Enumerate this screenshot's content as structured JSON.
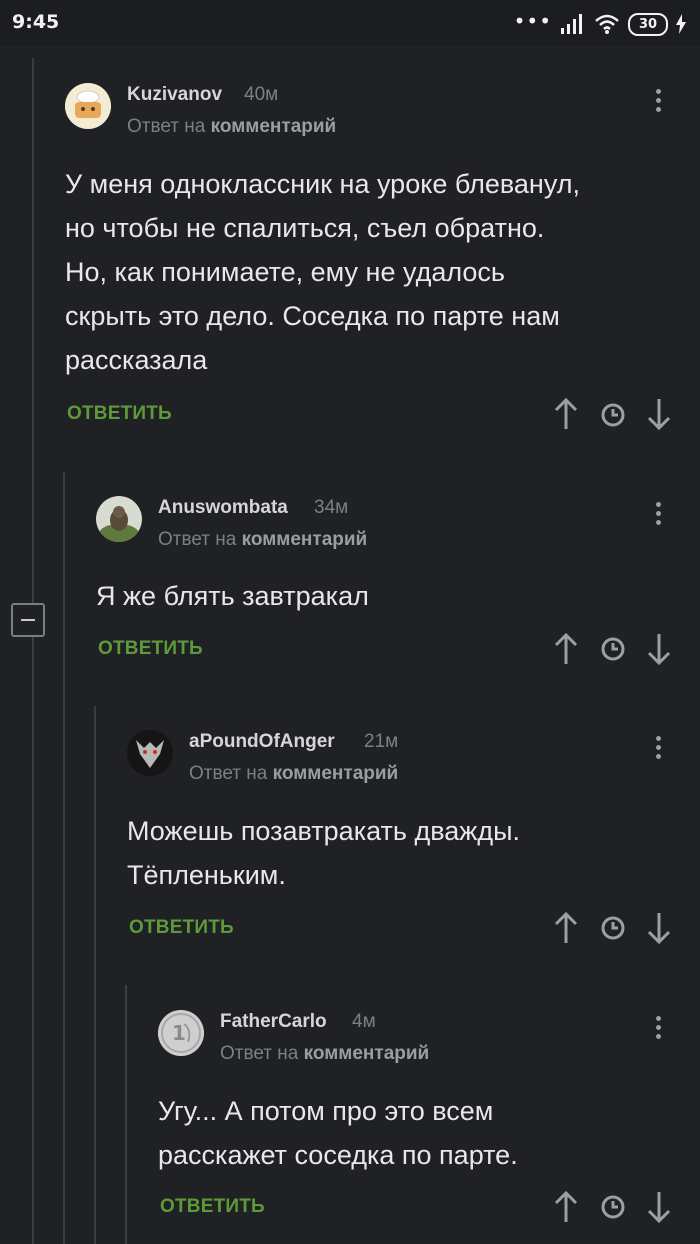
{
  "statusbar": {
    "time": "9:45",
    "battery": "30"
  },
  "labels": {
    "reply_to_prefix": "Ответ на",
    "reply_to_link": "комментарий",
    "reply_button": "ОТВЕТИТЬ"
  },
  "comments": [
    {
      "username": "Kuzivanov",
      "time": "40м",
      "text": [
        "У меня одноклассник на уроке блеванул,",
        "но чтобы не спалиться, съел обратно.",
        "Но, как понимаете, ему не удалось",
        "скрыть это дело. Соседка по парте нам",
        "рассказала"
      ]
    },
    {
      "username": "Anuswombata",
      "time": "34м",
      "text": [
        "Я же блять завтракал"
      ]
    },
    {
      "username": "aPoundOfAnger",
      "time": "21м",
      "text": [
        "Можешь позавтракать дважды.",
        "Тёпленьким."
      ]
    },
    {
      "username": "FatherCarlo",
      "time": "4м",
      "text": [
        "Угу... А потом про это всем",
        "расскажет соседка по парте."
      ]
    }
  ],
  "colors": {
    "background": "#1f2124",
    "reply_green": "#5f9a3a",
    "meta_gray": "#7c8086"
  }
}
